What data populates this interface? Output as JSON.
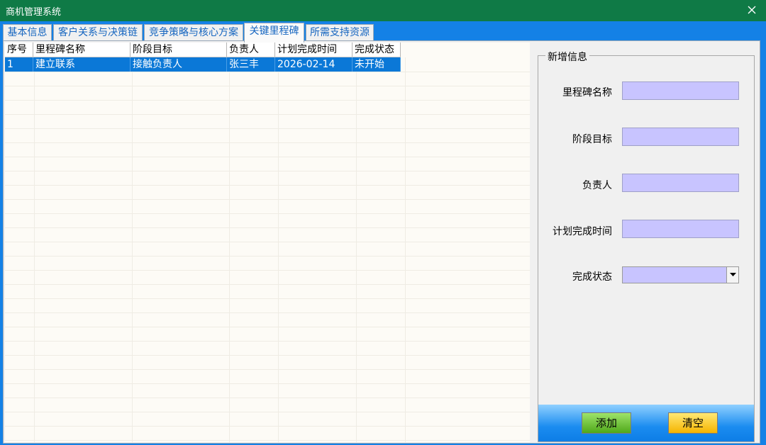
{
  "window": {
    "title": "商机管理系统",
    "close_icon": "close-icon"
  },
  "tabs": [
    {
      "label": "基本信息",
      "active": false
    },
    {
      "label": "客户关系与决策链",
      "active": false
    },
    {
      "label": "竞争策略与核心方案",
      "active": false
    },
    {
      "label": "关键里程碑",
      "active": true
    },
    {
      "label": "所需支持资源",
      "active": false
    }
  ],
  "grid": {
    "columns": [
      "序号",
      "里程碑名称",
      "阶段目标",
      "负责人",
      "计划完成时间",
      "完成状态"
    ],
    "rows": [
      [
        "1",
        "建立联系",
        "接触负责人",
        "张三丰",
        "2026-02-14",
        "未开始"
      ]
    ],
    "selected_row": 0
  },
  "form": {
    "legend": "新增信息",
    "fields": [
      {
        "label": "里程碑名称",
        "value": ""
      },
      {
        "label": "阶段目标",
        "value": ""
      },
      {
        "label": "负责人",
        "value": ""
      },
      {
        "label": "计划完成时间",
        "value": ""
      }
    ],
    "status": {
      "label": "完成状态",
      "value": ""
    },
    "add_label": "添加",
    "clear_label": "清空"
  },
  "colors": {
    "titlebar": "#0f7a46",
    "frame": "#1481e6",
    "selected_row": "#0b78d7",
    "input_bg": "#c8c4ff",
    "add_button": "#4fa81a",
    "clear_button": "#f5b400"
  }
}
